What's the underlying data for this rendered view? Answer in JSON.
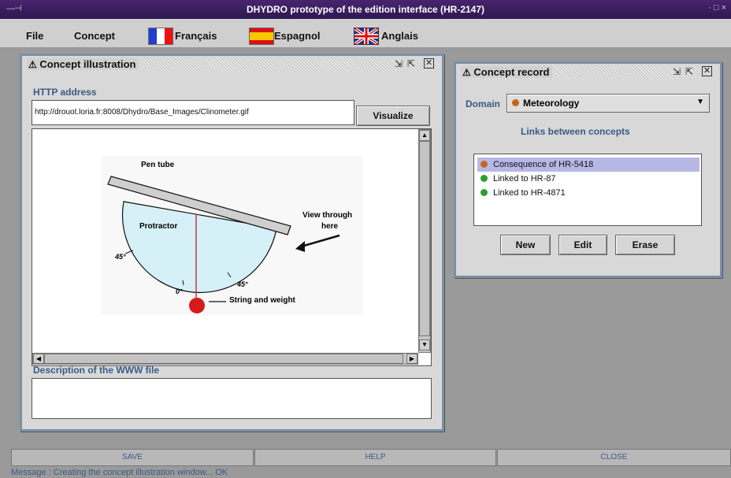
{
  "window": {
    "title": "DHYDRO prototype of the edition interface (HR-2147)",
    "left_controls": "—⊣",
    "right_controls": "·  □  ×"
  },
  "menubar": {
    "items": [
      "File",
      "Concept",
      "Français",
      "Espagnol",
      "Anglais"
    ]
  },
  "illustration_window": {
    "title": "Concept illustration",
    "http_label": "HTTP address",
    "url": "http://drouot.loria.fr:8008/Dhydro/Base_Images/Clinometer.gif",
    "visualize_label": "Visualize",
    "description_label": "Description of the WWW file",
    "description_value": "",
    "image_labels": {
      "pen_tube": "Pen tube",
      "protractor": "Protractor",
      "view_through": "View through",
      "here": "here",
      "deg45_left": "45°",
      "deg45_right": "45°",
      "deg0": "0°",
      "string_weight": "String and weight"
    }
  },
  "record_window": {
    "title": "Concept record",
    "domain_label": "Domain",
    "domain_value": "Meteorology",
    "links_label": "Links between concepts",
    "links": [
      {
        "label": "Consequence of HR-5418",
        "color": "#c8641e",
        "selected": true
      },
      {
        "label": "Linked to HR-87",
        "color": "#2aa02a",
        "selected": false
      },
      {
        "label": "Linked to HR-4871",
        "color": "#2aa02a",
        "selected": false
      }
    ],
    "buttons": {
      "new": "New",
      "edit": "Edit",
      "erase": "Erase"
    }
  },
  "bottom": {
    "save": "SAVE",
    "help": "HELP",
    "close": "CLOSE",
    "message": "Message :  Creating the concept illustration window... OK"
  },
  "colors": {
    "title_bar": "#3a1f5e",
    "accent_text": "#3a5a85",
    "selection": "#b7b7e6"
  }
}
